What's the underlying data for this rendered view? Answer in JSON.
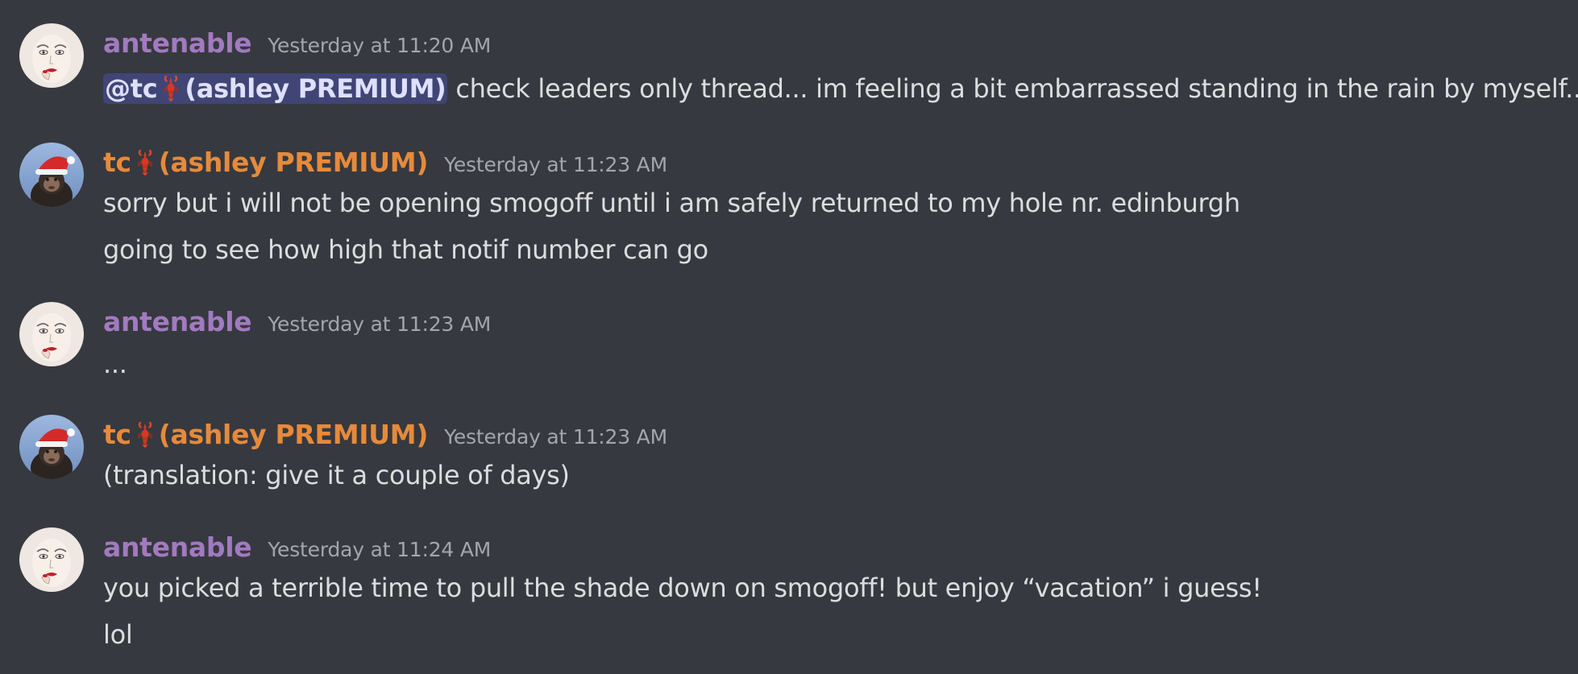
{
  "colors": {
    "background": "#36393f",
    "antenable_name": "#a27ac0",
    "tc_name": "#e68a3c",
    "text": "#dcddde",
    "timestamp": "#a3a6aa",
    "mention_bg": "#4a4f7a"
  },
  "messages": [
    {
      "avatar": "face-portrait-avatar",
      "author_name": "antenable",
      "timestamp": "Yesterday at 11:20 AM",
      "mention": {
        "prefix": "@tc",
        "icon": "lobster-icon",
        "suffix": "(ashley PREMIUM)"
      },
      "lines": [
        "check leaders only thread... im feeling a bit embarrassed standing in the rain by myself..."
      ]
    },
    {
      "avatar": "santa-monkey-avatar",
      "author_name_prefix": "tc",
      "author_icon": "lobster-icon",
      "author_name_suffix": "(ashley PREMIUM)",
      "timestamp": "Yesterday at 11:23 AM",
      "lines": [
        "sorry but i will not be opening smogoff until i am safely returned to my hole nr. edinburgh",
        "going to see how high that notif number can go"
      ]
    },
    {
      "avatar": "face-portrait-avatar",
      "author_name": "antenable",
      "timestamp": "Yesterday at 11:23 AM",
      "lines": [
        "..."
      ]
    },
    {
      "avatar": "santa-monkey-avatar",
      "author_name_prefix": "tc",
      "author_icon": "lobster-icon",
      "author_name_suffix": "(ashley PREMIUM)",
      "timestamp": "Yesterday at 11:23 AM",
      "lines": [
        "(translation: give it a couple of days)"
      ]
    },
    {
      "avatar": "face-portrait-avatar",
      "author_name": "antenable",
      "timestamp": "Yesterday at 11:24 AM",
      "lines": [
        "you picked a terrible time to pull the shade down on smogoff! but enjoy “vacation” i guess!",
        "lol"
      ]
    }
  ]
}
